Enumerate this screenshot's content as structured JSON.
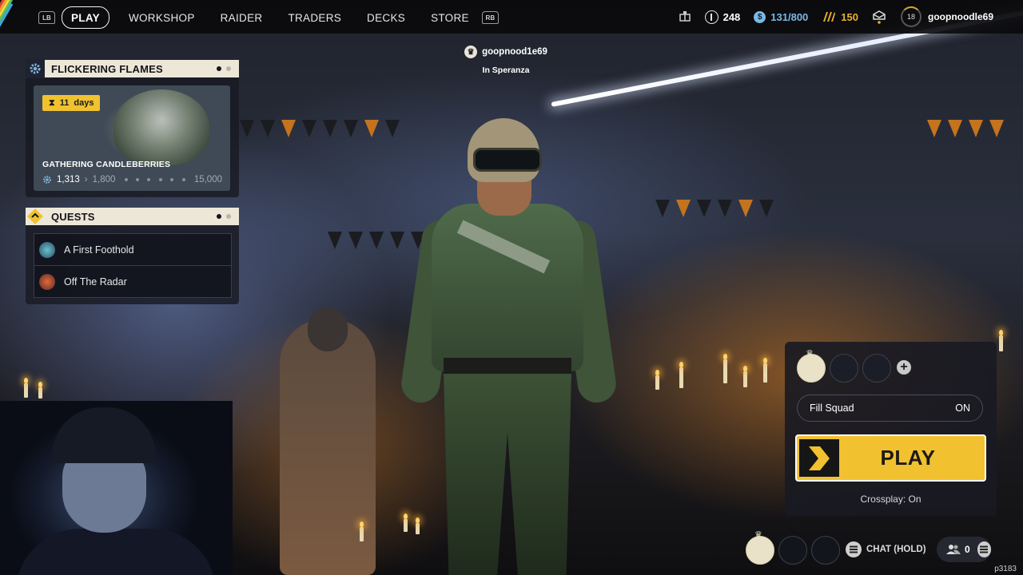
{
  "nav": {
    "lb": "LB",
    "rb": "RB",
    "items": [
      {
        "label": "PLAY",
        "active": true
      },
      {
        "label": "WORKSHOP",
        "active": false
      },
      {
        "label": "RAIDER",
        "active": false
      },
      {
        "label": "TRADERS",
        "active": false
      },
      {
        "label": "DECKS",
        "active": false
      },
      {
        "label": "STORE",
        "active": false
      }
    ]
  },
  "currencies": {
    "raider_tokens": "248",
    "stash": "131/800",
    "coins": "150",
    "level": "18",
    "username": "goopnoodle69"
  },
  "event": {
    "title": "FLICKERING FLAMES",
    "timer_value": "11",
    "timer_unit": "days",
    "card_title": "GATHERING CANDLEBERRIES",
    "progress_current": "1,313",
    "progress_next": "1,800",
    "progress_max": "15,000"
  },
  "quests": {
    "title": "QUESTS",
    "items": [
      {
        "label": "A First Foothold"
      },
      {
        "label": "Off The Radar"
      }
    ]
  },
  "player": {
    "name": "goopnood1e69",
    "location": "In Speranza"
  },
  "squad": {
    "fill_label": "Fill Squad",
    "fill_value": "ON",
    "play_label": "PLAY",
    "crossplay": "Crossplay: On"
  },
  "bottom": {
    "chat_label": "CHAT (HOLD)",
    "friends_count": "0",
    "build": "p3183"
  },
  "colors": {
    "accent_yellow": "#f2c12f",
    "panel_header": "#ede7d8",
    "stash_blue": "#7ab8e6",
    "coin_gold": "#e7b12e"
  }
}
